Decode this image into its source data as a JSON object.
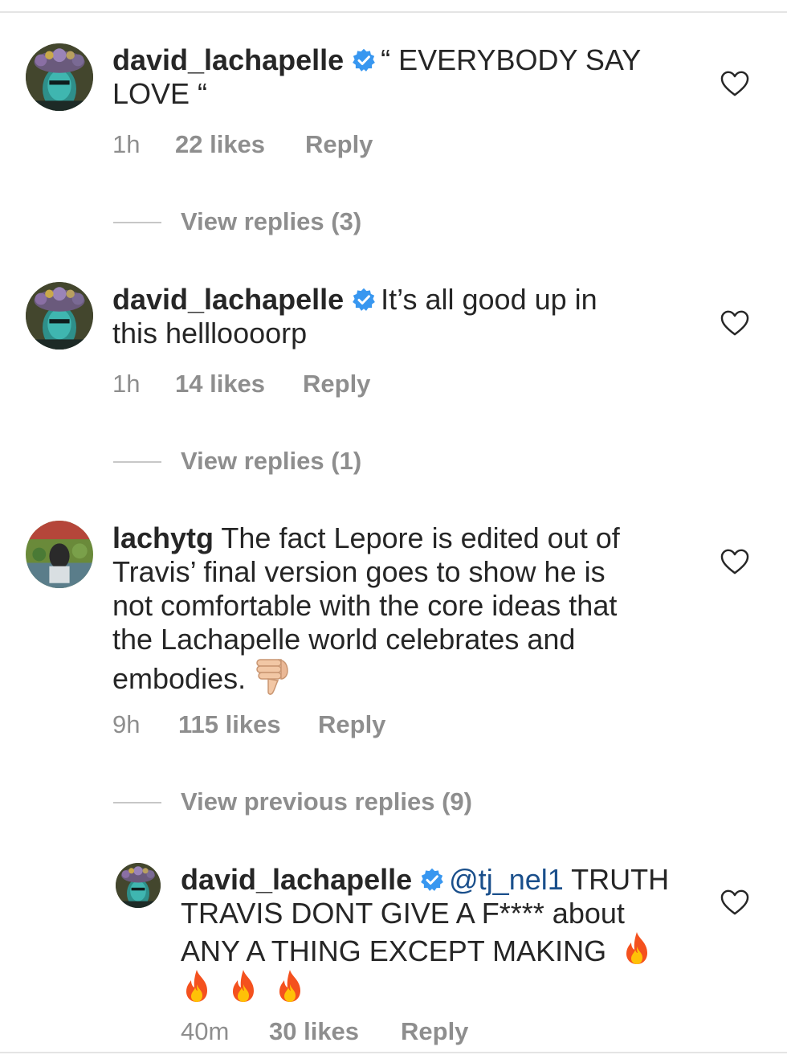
{
  "colors": {
    "text": "#262626",
    "secondary": "#8e8e8e",
    "verified": "#3897f0",
    "mention": "#1a4f8b"
  },
  "comments": [
    {
      "username": "david_lachapelle",
      "verified": true,
      "text_line1": "“ EVERYBODY SAY",
      "text_line2": "LOVE “",
      "time": "1h",
      "likes": "22 likes",
      "reply": "Reply",
      "view_replies": "View replies (3)"
    },
    {
      "username": "david_lachapelle",
      "verified": true,
      "text_line1": "It’s all good up in",
      "text_line2": "this  hellloooorp",
      "time": "1h",
      "likes": "14 likes",
      "reply": "Reply",
      "view_replies": "View replies (1)"
    },
    {
      "username": "lachytg",
      "verified": false,
      "text_line1": "The fact Lepore is edited out of",
      "text_line2": "Travis’ final version goes to show he is",
      "text_line3": "not comfortable with the core ideas that",
      "text_line4": "the Lachapelle world celebrates and",
      "text_line5": "embodies.",
      "emoji": "thumbs-down",
      "time": "9h",
      "likes": "115 likes",
      "reply": "Reply",
      "view_replies": "View previous replies (9)"
    },
    {
      "username": "david_lachapelle",
      "verified": true,
      "mention": "@tj_nel1",
      "text_line1": "TRUTH",
      "text_line2": "TRAVIS  DONT GIVE A F**** about",
      "text_line3": "ANY A THING EXCEPT MAKING",
      "emoji": "fire",
      "time": "40m",
      "likes": "30 likes",
      "reply": "Reply"
    }
  ]
}
